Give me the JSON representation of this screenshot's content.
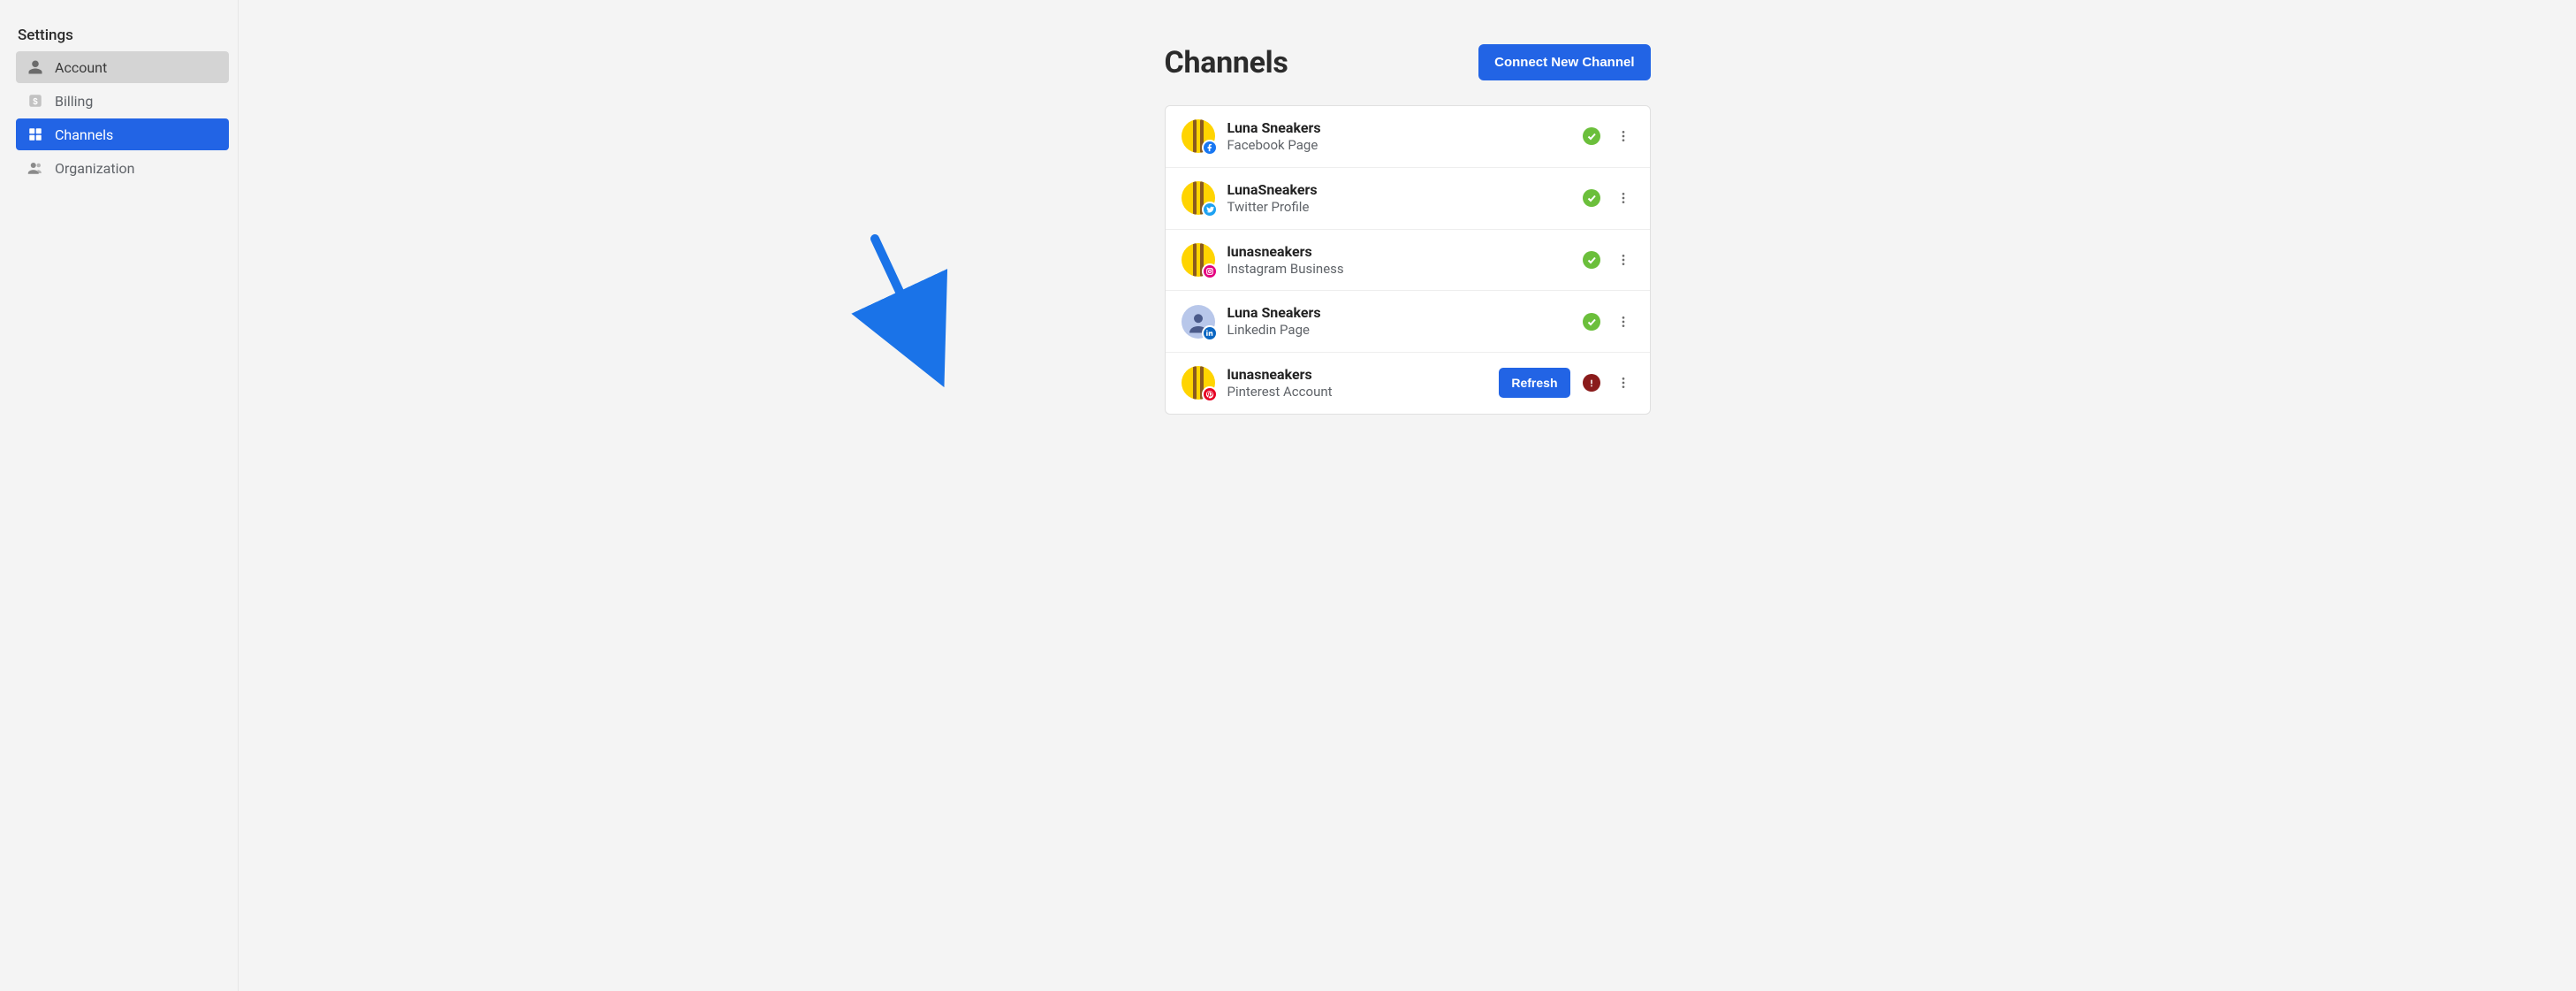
{
  "sidebar": {
    "title": "Settings",
    "items": [
      {
        "label": "Account"
      },
      {
        "label": "Billing"
      },
      {
        "label": "Channels"
      },
      {
        "label": "Organization"
      }
    ]
  },
  "header": {
    "title": "Channels",
    "connect_label": "Connect New Channel"
  },
  "refresh_label": "Refresh",
  "channels": [
    {
      "name": "Luna Sneakers",
      "type": "Facebook Page"
    },
    {
      "name": "LunaSneakers",
      "type": "Twitter Profile"
    },
    {
      "name": "lunasneakers",
      "type": "Instagram Business"
    },
    {
      "name": "Luna Sneakers",
      "type": "Linkedin Page"
    },
    {
      "name": "lunasneakers",
      "type": "Pinterest Account"
    }
  ],
  "badge_colors": {
    "facebook": "#1877f2",
    "twitter": "#1da1f2",
    "instagram": "#e4007f",
    "linkedin": "#0a66c2",
    "pinterest": "#e60023"
  }
}
